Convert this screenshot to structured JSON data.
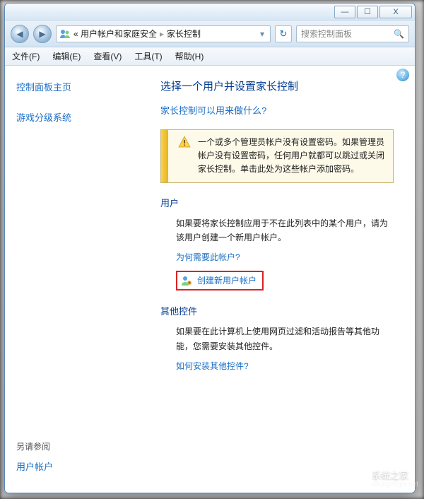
{
  "window": {
    "min": "—",
    "max": "☐",
    "close": "X"
  },
  "nav": {
    "back": "◀",
    "fwd": "▶",
    "refresh": "↻",
    "breadcrumb": {
      "seg1": "« 用户帐户和家庭安全",
      "seg2": "家长控制",
      "drop": "▾"
    },
    "search_placeholder": "搜索控制面板",
    "search_icon": "🔍"
  },
  "menu": {
    "file": "文件(F)",
    "edit": "编辑(E)",
    "view": "查看(V)",
    "tools": "工具(T)",
    "help": "帮助(H)"
  },
  "sidebar": {
    "home": "控制面板主页",
    "rating": "游戏分级系统",
    "see_also_header": "另请参阅",
    "user_accounts": "用户帐户"
  },
  "content": {
    "help": "?",
    "title": "选择一个用户并设置家长控制",
    "what_link": "家长控制可以用来做什么?",
    "warning": "一个或多个管理员帐户没有设置密码。如果管理员帐户没有设置密码，任何用户就都可以跳过或关闭家长控制。单击此处为这些帐户添加密码。",
    "users_h": "用户",
    "users_p": "如果要将家长控制应用于不在此列表中的某个用户，请为该用户创建一个新用户帐户。",
    "why_link": "为何需要此帐户?",
    "create_link": "创建新用户帐户",
    "other_h": "其他控件",
    "other_p": "如果要在此计算机上使用网页过滤和活动报告等其他功能，您需要安装其他控件。",
    "install_link": "如何安装其他控件?"
  },
  "watermark": {
    "title": "系统之家",
    "sub": "xitongzhijia.net"
  }
}
